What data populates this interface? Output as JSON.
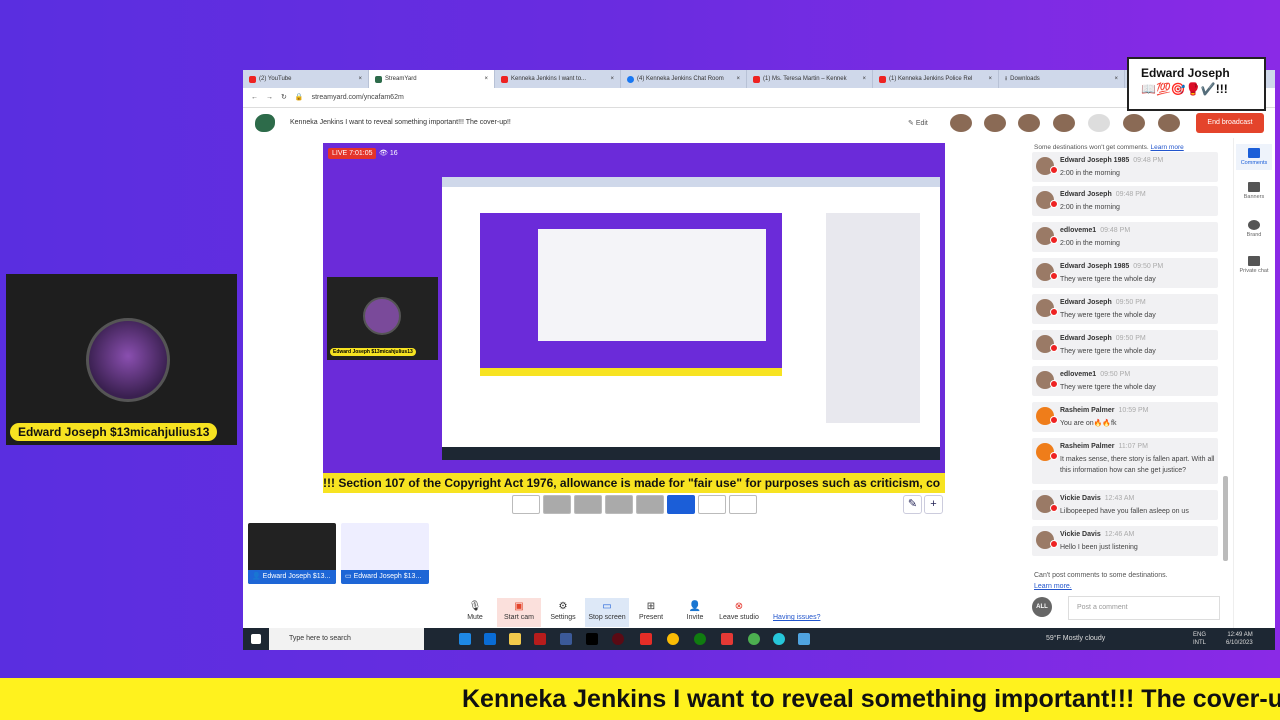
{
  "webcam": {
    "name_tag": "Edward Joseph $13micahjulius13"
  },
  "browser": {
    "tabs": [
      {
        "label": "(2) YouTube"
      },
      {
        "label": "StreamYard"
      },
      {
        "label": "Kenneka Jenkins I want to..."
      },
      {
        "label": "(4) Kenneka Jenkins Chat Room"
      },
      {
        "label": "(1) Ms. Teresa Martin – Kennek"
      },
      {
        "label": "(1) Kenneka Jenkins Police Rel"
      },
      {
        "label": "Downloads"
      }
    ],
    "url": "streamyard.com/yncafam62m"
  },
  "header": {
    "title": "Kenneka Jenkins I want to reveal something important!!! The cover-up!!",
    "edit": "Edit",
    "end_broadcast": "End broadcast"
  },
  "stage": {
    "live": "LIVE 7:01:05",
    "viewers": "16",
    "banner": "!!! Section 107 of the Copyright Act 1976, allowance is made for \"fair use\" for purposes such as criticism, co",
    "inner_cam_tag": "Edward Joseph $13micahjulius13"
  },
  "thumbs": [
    {
      "label": "Edward Joseph $13..."
    },
    {
      "label": "Edward Joseph $13..."
    }
  ],
  "toolbar": {
    "items": [
      {
        "label": "Mute",
        "icon": "🎙"
      },
      {
        "label": "Start cam",
        "icon": "▣"
      },
      {
        "label": "Settings",
        "icon": "⚙"
      },
      {
        "label": "Stop screen",
        "icon": "▭"
      },
      {
        "label": "Present",
        "icon": "⊞"
      },
      {
        "label": "Invite",
        "icon": "👤"
      },
      {
        "label": "Leave studio",
        "icon": "⊗"
      }
    ],
    "issues": "Having issues?"
  },
  "comments": {
    "note": "Some destinations won't get comments.",
    "learn_more": "Learn more",
    "items": [
      {
        "name": "Edward Joseph 1985",
        "time": "09:48 PM",
        "text": "2:00 in the morning"
      },
      {
        "name": "Edward Joseph",
        "time": "09:48 PM",
        "text": "2:00 in the morning"
      },
      {
        "name": "edloveme1",
        "time": "09:48 PM",
        "text": "2:00 in the morning"
      },
      {
        "name": "Edward Joseph 1985",
        "time": "09:50 PM",
        "text": "They were tgere the whole day"
      },
      {
        "name": "Edward Joseph",
        "time": "09:50 PM",
        "text": "They were tgere the whole day"
      },
      {
        "name": "Edward Joseph",
        "time": "09:50 PM",
        "text": "They were tgere the whole day"
      },
      {
        "name": "edloveme1",
        "time": "09:50 PM",
        "text": "They were tgere the whole day"
      },
      {
        "name": "Rasheim Palmer",
        "time": "10:59 PM",
        "text": "You are on🔥🔥fk"
      },
      {
        "name": "Rasheim Palmer",
        "time": "11:07 PM",
        "text": "It makes sense, there story is fallen apart. With all this information how can she get justice?"
      },
      {
        "name": "Vickie Davis",
        "time": "12:43 AM",
        "text": "Lilbopeeped have you fallen asleep on us"
      },
      {
        "name": "Vickie Davis",
        "time": "12:46 AM",
        "text": "Hello I been just listening"
      }
    ],
    "cant_post": "Can't post comments to some destinations.",
    "cant_learn": "Learn more.",
    "all": "ALL",
    "placeholder": "Post a comment"
  },
  "sidebar": [
    {
      "label": "Comments"
    },
    {
      "label": "Banners"
    },
    {
      "label": "Brand"
    },
    {
      "label": "Private chat"
    }
  ],
  "taskbar": {
    "search": "Type here to search",
    "weather": "59°F  Mostly cloudy",
    "lang1": "ENG",
    "lang2": "INTL",
    "time": "12:49 AM",
    "date": "6/10/2023"
  },
  "overlay": {
    "name": "Edward Joseph",
    "emojis": "📖💯🎯🥊✔️!!!"
  },
  "ticker": "Kenneka Jenkins I want to reveal something important!!! The cover-up!!"
}
